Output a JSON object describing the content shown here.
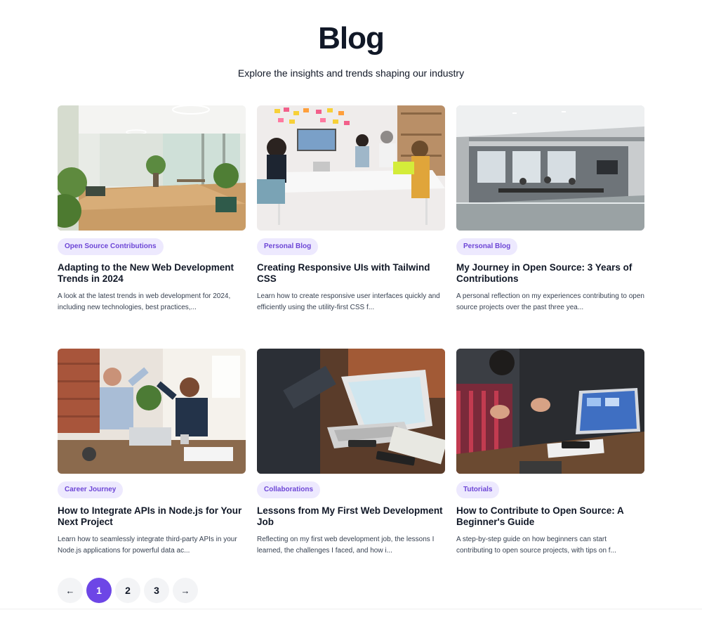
{
  "header": {
    "title": "Blog",
    "subtitle": "Explore the insights and trends shaping our industry"
  },
  "posts": [
    {
      "tag": "Open Source Contributions",
      "title": "Adapting to the New Web Development Trends in 2024",
      "excerpt": "A look at the latest trends in web development for 2024, including new technologies, best practices,..."
    },
    {
      "tag": "Personal Blog",
      "title": "Creating Responsive UIs with Tailwind CSS",
      "excerpt": "Learn how to create responsive user interfaces quickly and efficiently using the utility-first CSS f..."
    },
    {
      "tag": "Personal Blog",
      "title": "My Journey in Open Source: 3 Years of Contributions",
      "excerpt": "A personal reflection on my experiences contributing to open source projects over the past three yea..."
    },
    {
      "tag": "Career Journey",
      "title": "How to Integrate APIs in Node.js for Your Next Project",
      "excerpt": "Learn how to seamlessly integrate third-party APIs in your Node.js applications for powerful data ac..."
    },
    {
      "tag": "Collaborations",
      "title": "Lessons from My First Web Development Job",
      "excerpt": "Reflecting on my first web development job, the lessons I learned, the challenges I faced, and how i..."
    },
    {
      "tag": "Tutorials",
      "title": "How to Contribute to Open Source: A Beginner's Guide",
      "excerpt": "A step-by-step guide on how beginners can start contributing to open source projects, with tips on f..."
    }
  ],
  "pagination": {
    "prev": "←",
    "pages": [
      "1",
      "2",
      "3"
    ],
    "current": "1",
    "next": "→"
  },
  "colors": {
    "accent": "#6d46e6",
    "tag_bg": "#ede9fe",
    "tag_text": "#6d46d6"
  }
}
